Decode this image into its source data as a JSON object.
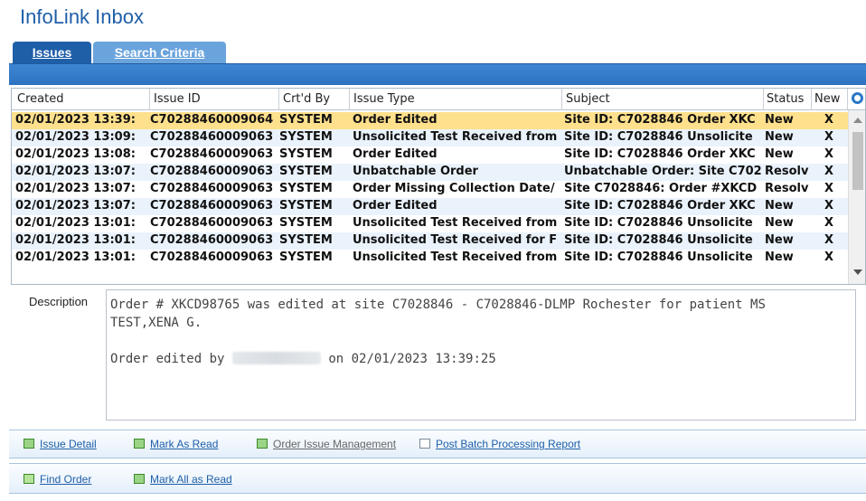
{
  "app": {
    "title": "InfoLink Inbox"
  },
  "tabs": [
    {
      "label": "Issues"
    },
    {
      "label": "Search Criteria"
    }
  ],
  "grid": {
    "columns": [
      "Created",
      "Issue ID",
      "Crt'd By",
      "Issue Type",
      "Subject",
      "Status",
      "New"
    ],
    "rows": [
      [
        "02/01/2023 13:39:",
        "C70288460009064",
        "SYSTEM",
        "Order Edited",
        "Site ID: C7028846 Order XKC",
        "New",
        "X"
      ],
      [
        "02/01/2023 13:09:",
        "C70288460009063",
        "SYSTEM",
        "Unsolicited Test Received from",
        "Site ID: C7028846 Unsolicite",
        "New",
        "X"
      ],
      [
        "02/01/2023 13:08:",
        "C70288460009063",
        "SYSTEM",
        "Order Edited",
        "Site ID: C7028846 Order XKC",
        "New",
        "X"
      ],
      [
        "02/01/2023 13:07:",
        "C70288460009063",
        "SYSTEM",
        "Unbatchable Order",
        "Unbatchable Order: Site C702",
        "Resolv",
        "X"
      ],
      [
        "02/01/2023 13:07:",
        "C70288460009063",
        "SYSTEM",
        "Order Missing Collection Date/",
        "Site C7028846: Order #XKCD",
        "Resolv",
        "X"
      ],
      [
        "02/01/2023 13:07:",
        "C70288460009063",
        "SYSTEM",
        "Order Edited",
        "Site ID: C7028846 Order XKC",
        "New",
        "X"
      ],
      [
        "02/01/2023 13:01:",
        "C70288460009063",
        "SYSTEM",
        "Unsolicited Test Received from",
        "Site ID: C7028846 Unsolicite",
        "New",
        "X"
      ],
      [
        "02/01/2023 13:01:",
        "C70288460009063",
        "SYSTEM",
        "Unsolicited Test Received for F",
        "Site ID: C7028846 Unsolicite",
        "New",
        "X"
      ],
      [
        "02/01/2023 13:01:",
        "C70288460009063",
        "SYSTEM",
        "Unsolicited Test Received from",
        "Site ID: C7028846 Unsolicite",
        "New",
        "X"
      ]
    ]
  },
  "description": {
    "label": "Description",
    "line1": "Order # XKCD98765 was edited at site C7028846 - C7028846-DLMP Rochester for patient MS",
    "line2": "TEST,XENA G.",
    "line3_prefix": "Order edited by",
    "line3_suffix": "on 02/01/2023 13:39:25"
  },
  "links_row1": {
    "issue_detail": "Issue Detail",
    "mark_as_read": "Mark As Read",
    "order_issue_management": "Order Issue Management",
    "post_batch_report": "Post Batch Processing Report"
  },
  "links_row2": {
    "find_order": "Find Order",
    "mark_all_as_read": "Mark All as Read"
  }
}
